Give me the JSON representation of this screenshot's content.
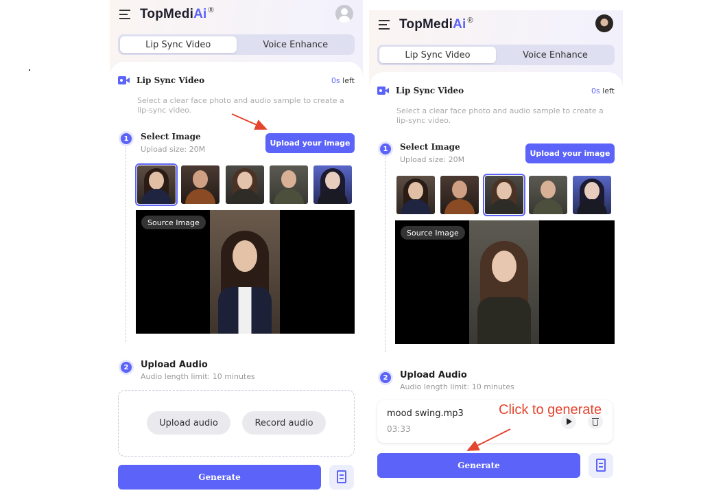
{
  "colors": {
    "accent": "#5b63f8",
    "annotation": "#e4452f"
  },
  "left": {
    "logo": {
      "text": "TopMedi",
      "ai": "Ai",
      "mark": "®"
    },
    "tabs": [
      {
        "label": "Lip Sync Video",
        "active": true
      },
      {
        "label": "Voice Enhance",
        "active": false
      }
    ],
    "section": {
      "title": "Lip Sync Video",
      "time_value": "0s",
      "time_suffix": " left",
      "description": "Select a clear face photo and audio sample to create a lip-sync video."
    },
    "step1": {
      "number": "1",
      "title": "Select Image",
      "subtitle": "Upload size: 20M",
      "upload_label": "Upload your image"
    },
    "thumbnails": {
      "selected_index": 0
    },
    "source_badge": "Source Image",
    "step2": {
      "number": "2",
      "title": "Upload Audio",
      "subtitle": "Audio length limit: 10 minutes"
    },
    "audio_buttons": {
      "upload": "Upload audio",
      "record": "Record audio"
    },
    "generate": "Generate"
  },
  "right": {
    "logo": {
      "text": "TopMedi",
      "ai": "Ai",
      "mark": "®"
    },
    "tabs": [
      {
        "label": "Lip Sync Video",
        "active": true
      },
      {
        "label": "Voice Enhance",
        "active": false
      }
    ],
    "section": {
      "title": "Lip Sync Video",
      "time_value": "0s",
      "time_suffix": " left",
      "description": "Select a clear face photo and audio sample to create a lip-sync video."
    },
    "step1": {
      "number": "1",
      "title": "Select Image",
      "subtitle": "Upload size: 20M",
      "upload_label": "Upload your image"
    },
    "thumbnails": {
      "selected_index": 2
    },
    "source_badge": "Source Image",
    "step2": {
      "number": "2",
      "title": "Upload Audio",
      "subtitle": "Audio length limit: 10 minutes"
    },
    "audio_file": {
      "name": "mood swing.mp3",
      "duration": "03:33"
    },
    "generate": "Generate",
    "annotation": "Click to generate"
  }
}
